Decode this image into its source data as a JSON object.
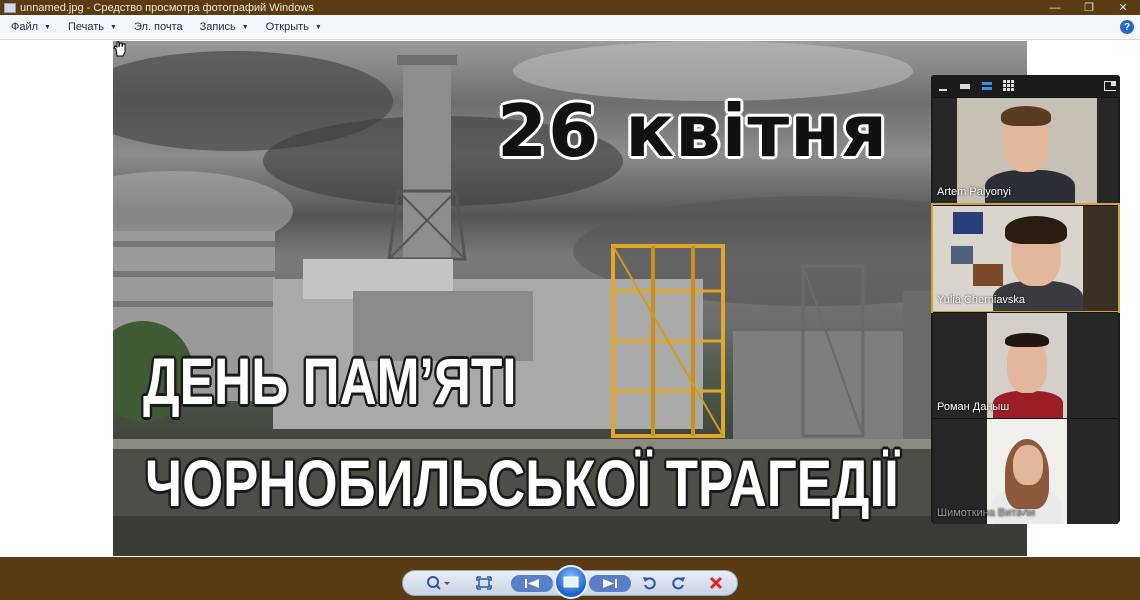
{
  "window": {
    "title": "unnamed.jpg - Средство просмотра фотографий Windows",
    "minimize": "—",
    "restore": "❐",
    "close": "✕"
  },
  "menu": {
    "items": [
      {
        "label": "Файл",
        "has_caret": true
      },
      {
        "label": "Печать",
        "has_caret": true
      },
      {
        "label": "Эл. почта",
        "has_caret": false
      },
      {
        "label": "Запись",
        "has_caret": true
      },
      {
        "label": "Открыть",
        "has_caret": true
      }
    ],
    "caret": "▼",
    "help": "?"
  },
  "photo": {
    "date_text": "26 квітня",
    "line1": "ДЕНЬ ПАМ’ЯТІ",
    "line2": "ЧОРНОБИЛЬСЬКОЇ ТРАГЕДІЇ"
  },
  "zoom": {
    "participants": [
      {
        "name": "Artem Palyonyi",
        "active": false
      },
      {
        "name": "Yulia Cherniavska",
        "active": true
      },
      {
        "name": "Роман Даныш",
        "active": false
      },
      {
        "name": "Шимоткина Витали",
        "active": false
      }
    ],
    "scroll_glyph": "⌄"
  },
  "toolbar": {
    "buttons": [
      "zoom",
      "fit",
      "previous",
      "slideshow",
      "next",
      "rotate-left",
      "rotate-right",
      "delete"
    ]
  },
  "colors": {
    "titlebar": "#5b3b13",
    "menubar": "#f4f7fc",
    "zoom_panel": "#1b1b1b",
    "active_speaker": "#d0a23a",
    "delete_red": "#d8262b"
  }
}
